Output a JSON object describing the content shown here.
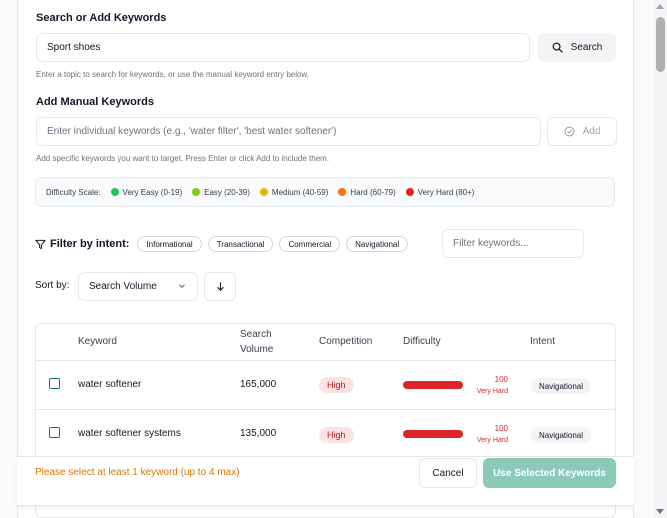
{
  "search": {
    "title": "Search or Add Keywords",
    "value": "Sport shoes",
    "button_label": "Search",
    "hint": "Enter a topic to search for keywords, or use the manual keyword entry below."
  },
  "manual": {
    "title": "Add Manual Keywords",
    "placeholder": "Enter individual keywords (e.g., 'water filter', 'best water softener')",
    "button_label": "Add",
    "hint": "Add specific keywords you want to target. Press Enter or click Add to include them."
  },
  "difficulty_scale": {
    "label": "Difficulty Scale:",
    "levels": [
      {
        "label": "Very Easy (0-19)",
        "color": "#22c55e"
      },
      {
        "label": "Easy (20-39)",
        "color": "#84cc16"
      },
      {
        "label": "Medium (40-59)",
        "color": "#eab308"
      },
      {
        "label": "Hard (60-79)",
        "color": "#f97316"
      },
      {
        "label": "Very Hard (80+)",
        "color": "#dc2626"
      }
    ]
  },
  "filter": {
    "label": "Filter by intent:",
    "intents": [
      "Informational",
      "Transactional",
      "Commercial",
      "Navigational"
    ],
    "keyword_placeholder": "Filter keywords..."
  },
  "sort": {
    "label": "Sort by:",
    "selected": "Search Volume"
  },
  "table": {
    "headers": {
      "keyword": "Keyword",
      "volume_line1": "Search",
      "volume_line2": "Volume",
      "competition": "Competition",
      "difficulty": "Difficulty",
      "intent": "Intent"
    },
    "rows": [
      {
        "keyword": "water softener",
        "volume": "165,000",
        "competition": "High",
        "difficulty": "100",
        "difficulty_level": "Very Hard",
        "intent": "Navigational"
      },
      {
        "keyword": "water softener systems",
        "volume": "135,000",
        "competition": "High",
        "difficulty": "100",
        "difficulty_level": "Very Hard",
        "intent": "Navigational"
      }
    ]
  },
  "footer": {
    "warning": "Please select at least 1 keyword (up to 4 max)",
    "cancel_label": "Cancel",
    "use_label": "Use Selected Keywords"
  },
  "colors": {
    "accent": "#0f766e",
    "use_button": "#8cc9b8",
    "warning": "#d97706",
    "very_hard": "#dc2626"
  }
}
